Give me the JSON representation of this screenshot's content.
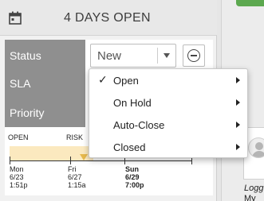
{
  "header": {
    "title": "4 DAYS OPEN",
    "icon": "calendar-icon"
  },
  "fields": {
    "status_label": "Status",
    "sla_label": "SLA",
    "priority_label": "Priority"
  },
  "status": {
    "value": "New",
    "clear_icon": "minus-circle-icon"
  },
  "menu": {
    "items": [
      {
        "label": "Open",
        "checked": true
      },
      {
        "label": "On Hold",
        "checked": false
      },
      {
        "label": "Auto-Close",
        "checked": false
      },
      {
        "label": "Closed",
        "checked": false
      }
    ],
    "check_glyph": "✓"
  },
  "timeline": {
    "open_label": "OPEN",
    "risk_label": "RISK",
    "dates": [
      {
        "day": "Mon",
        "date": "6/23",
        "time": "1:51p"
      },
      {
        "day": "Fri",
        "date": "6/27",
        "time": "1:15a"
      },
      {
        "day": "Sun",
        "date": "6/29",
        "time": "7:00p"
      }
    ]
  },
  "side": {
    "log_text": "Logg",
    "log_text2": "My"
  },
  "colors": {
    "accent_green": "#5ca84f",
    "label_bg": "#8f8f8f",
    "risk_band": "#fbe9bf",
    "risk_marker": "#e6b94d"
  }
}
